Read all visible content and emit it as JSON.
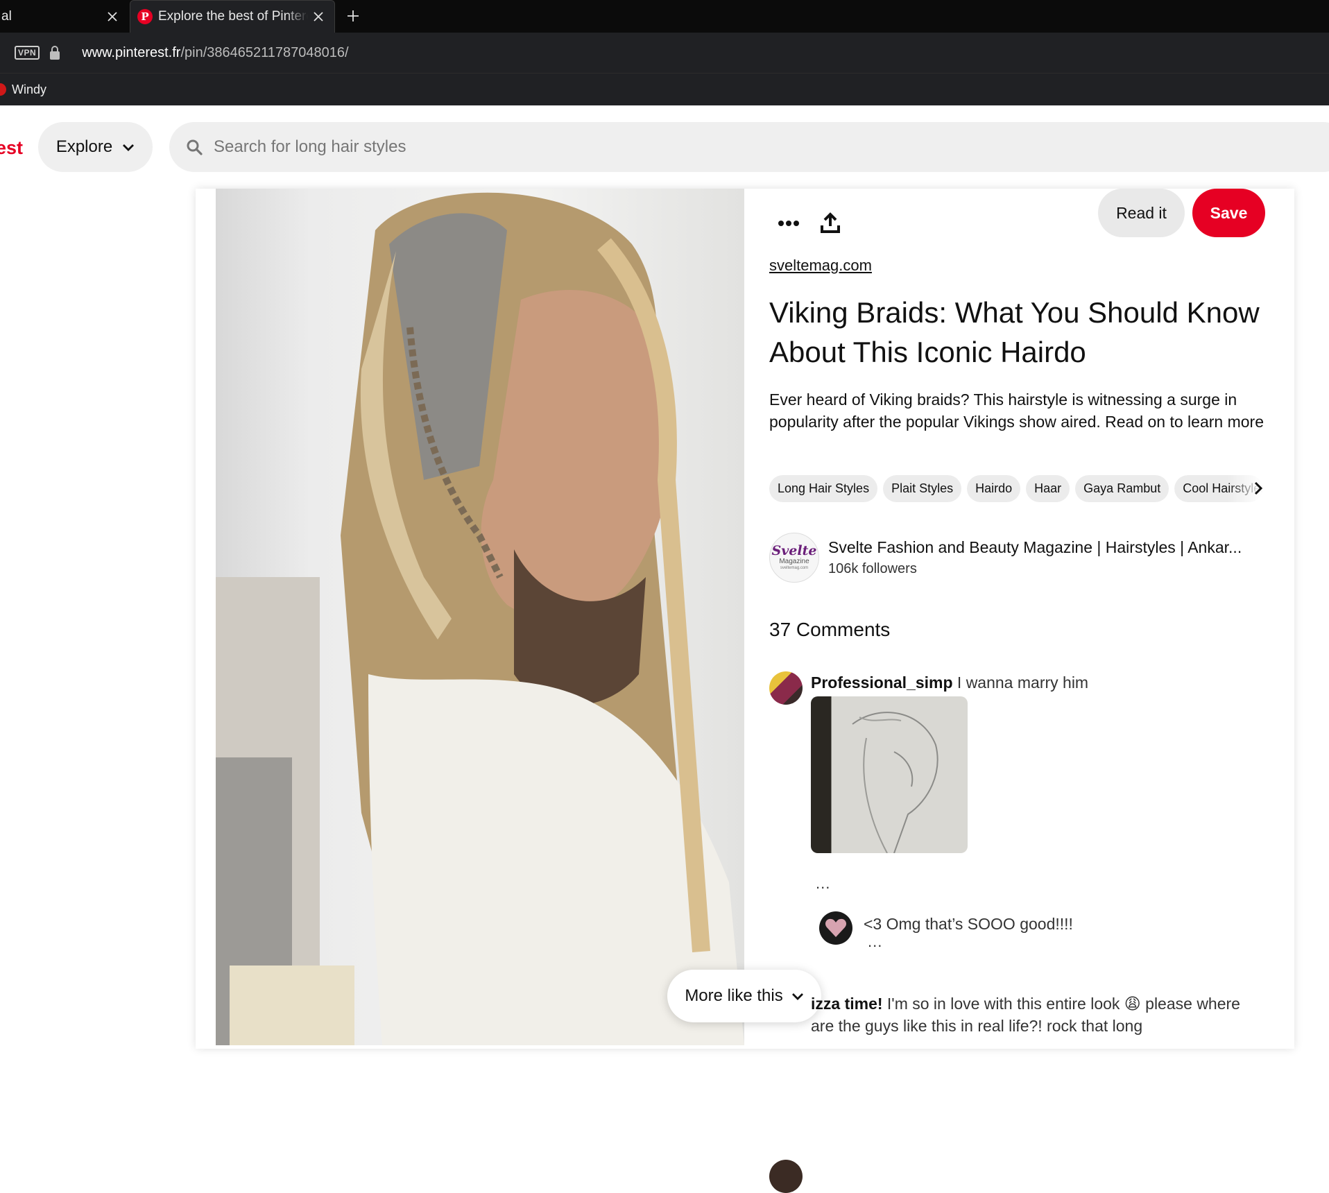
{
  "browser": {
    "tabs": [
      {
        "title": "al",
        "active": false
      },
      {
        "title": "Explore the best of Pinterest",
        "active": true
      }
    ],
    "vpn_label": "VPN",
    "url_domain": "www.pinterest.fr",
    "url_path": "/pin/386465211787048016/",
    "bookmarks": [
      "Windy"
    ]
  },
  "header": {
    "logo_text": "est",
    "explore_label": "Explore",
    "search_placeholder": "Search for long hair styles"
  },
  "pin": {
    "read_label": "Read it",
    "save_label": "Save",
    "source": "sveltemag.com",
    "title": "Viking Braids: What You Should Know About This Iconic Hairdo",
    "description": "Ever heard of Viking braids? This hairstyle is witnessing a surge in popularity after the popular Vikings show aired. Read on to learn more",
    "tags": [
      "Long Hair Styles",
      "Plait Styles",
      "Hairdo",
      "Haar",
      "Gaya Rambut",
      "Cool Hairstyles"
    ],
    "creator": {
      "avatar_line1": "Svelte",
      "avatar_line2": "Magazine",
      "avatar_line3": "sveltemag.com",
      "name": "Svelte Fashion and Beauty Magazine | Hairstyles | Ankar...",
      "followers": "106k followers"
    },
    "comments_heading": "37 Comments",
    "comments": [
      {
        "user": "Professional_simp",
        "text": "I wanna marry him"
      },
      {
        "user": "",
        "text": "<3 Omg that’s SOOO good!!!!"
      },
      {
        "user": "izza time!",
        "text": "I'm so in love with this entire look 😩 please where are the guys like this in real life?! rock that long"
      }
    ],
    "more_dots": "...",
    "more_like_label": "More like this"
  },
  "colors": {
    "brand_red": "#e60023",
    "chrome_dark": "#202124",
    "pill_gray": "#efefef"
  }
}
